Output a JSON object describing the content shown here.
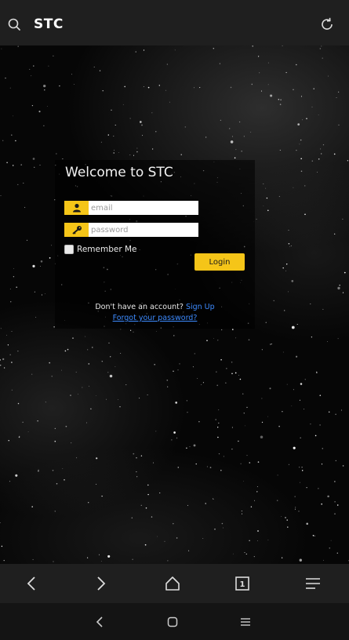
{
  "browser": {
    "site_title": "STC"
  },
  "login": {
    "title": "Welcome to STC",
    "email_placeholder": "email",
    "password_placeholder": "password",
    "remember_label": "Remember Me",
    "login_label": "Login",
    "no_account_text": "Don't have an account?",
    "signup_label": "Sign Up",
    "forgot_label": "Forgot your password?"
  },
  "toolbar": {
    "tab_count": "1"
  },
  "colors": {
    "accent": "#f5c518",
    "link": "#3d8bff",
    "bar": "#1f1f1f"
  },
  "icons": {
    "top": [
      "search-icon",
      "reload-icon"
    ],
    "toolbar": [
      "back-arrow-icon",
      "forward-arrow-icon",
      "home-icon",
      "tabs-icon",
      "menu-icon"
    ],
    "system": [
      "nav-back-icon",
      "nav-home-icon",
      "nav-recents-icon"
    ]
  }
}
